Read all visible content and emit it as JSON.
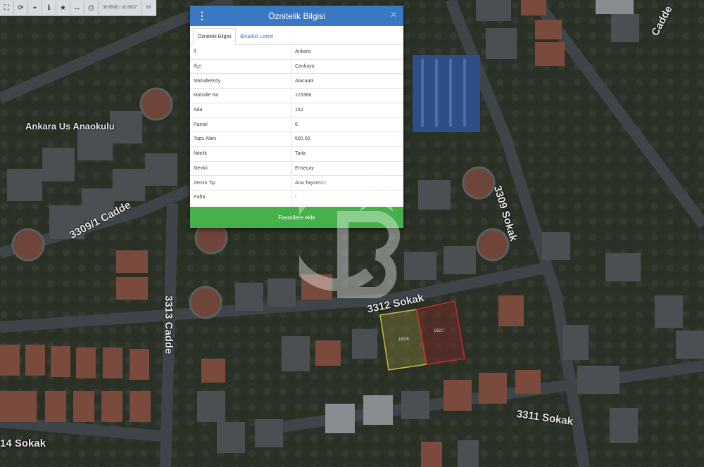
{
  "toolbar": {
    "coordinates": "39.8588 / 32.8827",
    "zoom": "18"
  },
  "map": {
    "labels": {
      "anaokulu": "Ankara Us Anaokulu",
      "cadde_3309_1": "3309/1 Cadde",
      "sokak_3309": "3309 Sokak",
      "cadde_3313": "3313 Cadde",
      "sokak_3312": "3312 Sokak",
      "sokak_3311": "3311 Sokak",
      "sokak_14": "14 Sokak",
      "cadde_top": "Cadde"
    },
    "parcels": [
      {
        "label": "162/6",
        "color": "#c9b84a"
      },
      {
        "label": "162/7",
        "color": "#c72a2a"
      }
    ]
  },
  "dialog": {
    "title": "Öznitelik Bilgisi",
    "tabs": [
      "Öznitelik Bilgisi",
      "Bina/BB Listesi"
    ],
    "rows": [
      {
        "key": "İl",
        "value": "Ankara"
      },
      {
        "key": "İlçe",
        "value": "Çankaya"
      },
      {
        "key": "Mahalle/Köy",
        "value": "Alacaatlı"
      },
      {
        "key": "Mahalle No",
        "value": "123366"
      },
      {
        "key": "Ada",
        "value": "162"
      },
      {
        "key": "Parsel",
        "value": "6"
      },
      {
        "key": "Tapu Alanı",
        "value": "600,00"
      },
      {
        "key": "Nitelik",
        "value": "Tarla"
      },
      {
        "key": "Mevkii",
        "value": "Enseçay"
      },
      {
        "key": "Zemin Tip",
        "value": "Ana Taşınmaz"
      },
      {
        "key": "Pafta",
        "value": "-"
      }
    ],
    "favorite_button": "Favorilere ekle"
  },
  "colors": {
    "header": "#3a78c3",
    "favorite": "#47b04b"
  }
}
